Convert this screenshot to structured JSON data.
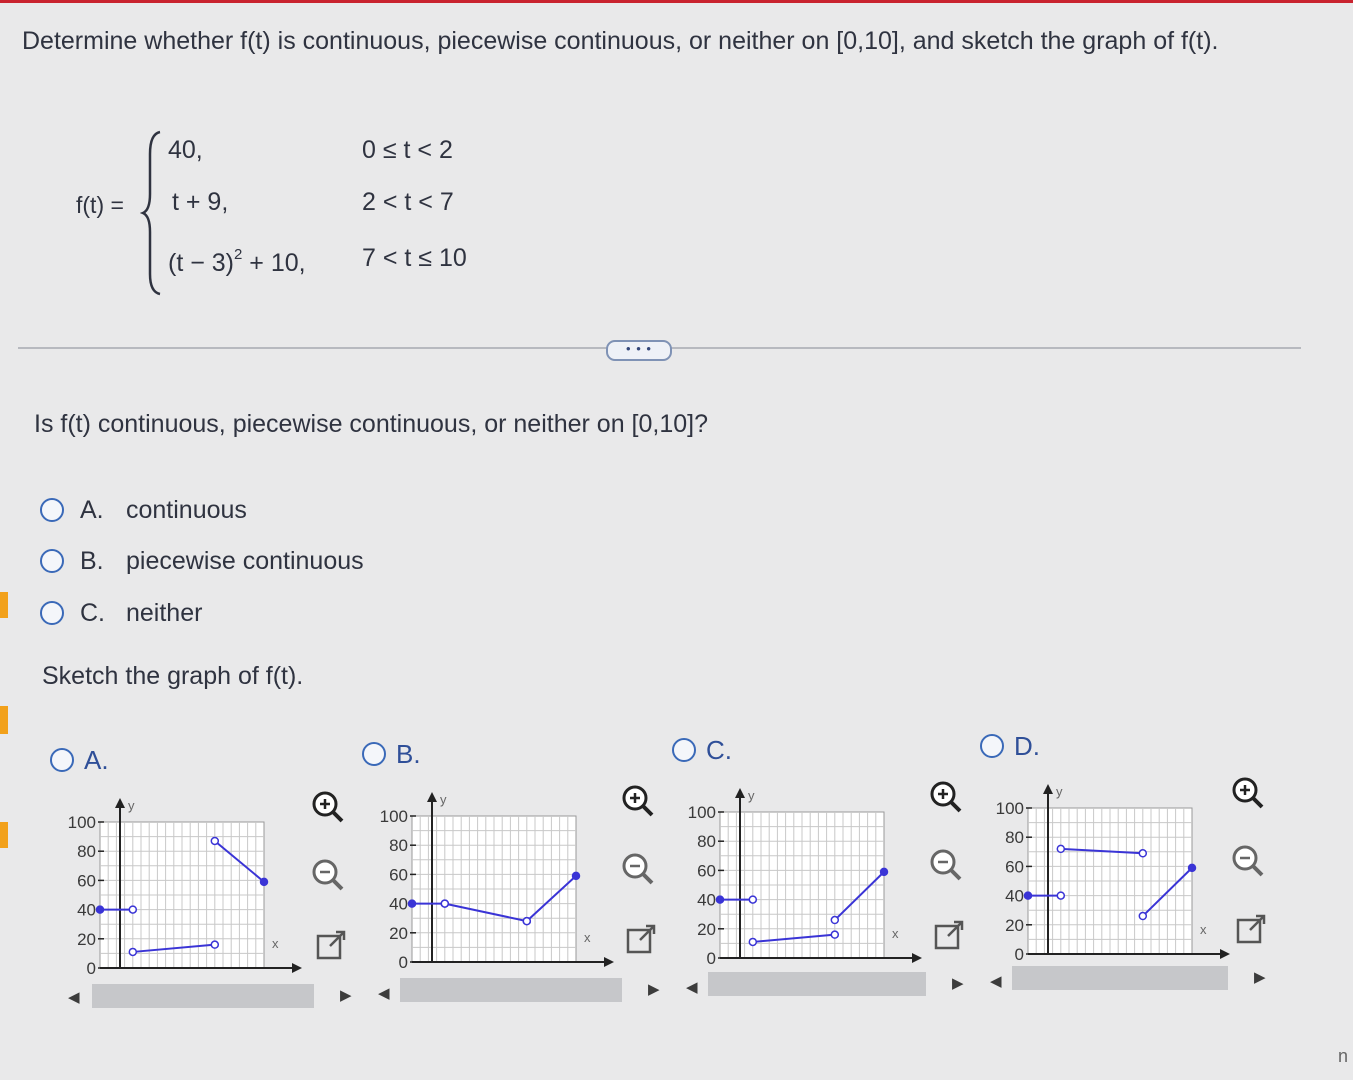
{
  "prompt": "Determine whether f(t) is continuous, piecewise continuous, or neither on [0,10], and sketch the graph of f(t).",
  "function": {
    "label": "f(t) =",
    "cases": [
      {
        "expr": "40,",
        "cond": "0 ≤ t < 2"
      },
      {
        "expr": "t + 9,",
        "cond": "2 < t < 7"
      },
      {
        "expr_base": "(t − 3)",
        "expr_exp": "2",
        "expr_tail": " + 10,",
        "cond": "7 < t ≤ 10"
      }
    ]
  },
  "expand_label": "• • •",
  "question": "Is f(t) continuous, piecewise continuous, or neither on [0,10]?",
  "answers": [
    {
      "letter": "A.",
      "text": "continuous"
    },
    {
      "letter": "B.",
      "text": "piecewise continuous"
    },
    {
      "letter": "C.",
      "text": "neither"
    }
  ],
  "sketch_prompt": "Sketch the graph of f(t).",
  "graph_options": [
    {
      "letter": "A.",
      "segments": [
        [
          [
            0,
            40
          ],
          [
            2,
            40
          ]
        ],
        [
          [
            2,
            11
          ],
          [
            7,
            16
          ]
        ],
        [
          [
            7,
            87
          ],
          [
            10,
            59
          ]
        ]
      ]
    },
    {
      "letter": "B.",
      "segments": [
        [
          [
            0,
            40
          ],
          [
            2,
            40
          ]
        ],
        [
          [
            2,
            40
          ],
          [
            7,
            28
          ]
        ],
        [
          [
            7,
            28
          ],
          [
            10,
            59
          ]
        ]
      ]
    },
    {
      "letter": "C.",
      "segments": [
        [
          [
            0,
            40
          ],
          [
            2,
            40
          ]
        ],
        [
          [
            2,
            11
          ],
          [
            7,
            16
          ]
        ],
        [
          [
            7,
            26
          ],
          [
            10,
            59
          ]
        ]
      ]
    },
    {
      "letter": "D.",
      "segments": [
        [
          [
            0,
            40
          ],
          [
            2,
            40
          ]
        ],
        [
          [
            2,
            72
          ],
          [
            7,
            69
          ]
        ],
        [
          [
            7,
            26
          ],
          [
            10,
            59
          ]
        ]
      ]
    }
  ],
  "graph_axis": {
    "x_label": "x",
    "y_label": "y",
    "y_ticks": [
      "100",
      "80",
      "60",
      "40",
      "20",
      "0"
    ],
    "xlim": [
      0,
      10
    ],
    "ylim": [
      0,
      100
    ]
  },
  "colors": {
    "accent": "#3a69b8",
    "curve": "#3a34d6",
    "alert": "#c9232f"
  },
  "icons": [
    "zoom-in-icon",
    "zoom-out-icon",
    "external-link-icon"
  ],
  "corner_text": "n"
}
